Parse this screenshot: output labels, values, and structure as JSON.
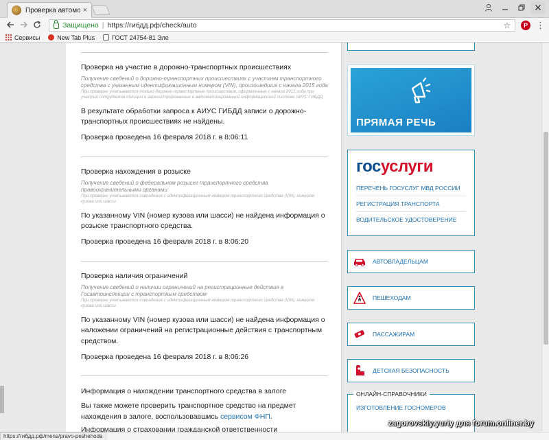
{
  "browser": {
    "tab_title": "Проверка автомобиля",
    "tab_close": "×",
    "secure_label": "Защищено",
    "url": "https://гибдд.рф/check/auto",
    "bookmarks": [
      {
        "label": "Сервисы"
      },
      {
        "label": "New Tab Plus"
      },
      {
        "label": "ГОСТ 24754-81 Эле"
      }
    ],
    "ext_label": "P",
    "icons": {
      "back": "back-arrow-icon",
      "forward": "forward-arrow-icon",
      "reload": "reload-icon",
      "star": "star-icon",
      "menu": "menu-icon"
    }
  },
  "sections": [
    {
      "title": "Проверка на участие в дорожно-транспортных происшествиях",
      "desc": "Получение сведений о дорожно-транспортных происшествиях с участием транспортного средства с указанным идентификационным номером (VIN), произошедших с начала 2015 года",
      "note": "При проверке учитываются только дорожно-транспортные происшествия, оформленные с начала 2015 года при участии сотрудников полиции и зарегистрированные в автоматизированной информационной системе АИУС ГИБДД",
      "result": "В результате обработки запроса к АИУС ГИБДД записи о дорожно-транспортных происшествиях не найдены.",
      "date": "Проверка проведена 16 февраля 2018 г. в 8:06:11"
    },
    {
      "title": "Проверка нахождения в розыске",
      "desc": "Получение сведений о федеральном розыске транспортного средства правоохранительными органами",
      "note": "При проверке учитываются совпадения с идентификационным номером транспортного средства (VIN), номером кузова или шасси",
      "result": "По указанному VIN (номер кузова или шасси) не найдена информация о розыске транспортного средства.",
      "date": "Проверка проведена 16 февраля 2018 г. в 8:06:20"
    },
    {
      "title": "Проверка наличия ограничений",
      "desc": "Получение сведений о наличии ограничений на регистрационные действия в Госавтоинспекции с транспортным средством",
      "note": "При проверке учитываются совпадения с идентификационным номером транспортного средства (VIN), номером кузова или шасси",
      "result": "По указанному VIN (номер кузова или шасси) не найдена информация о наложении ограничений на регистрационные действия с транспортным средством.",
      "date": "Проверка проведена 16 февраля 2018 г. в 8:06:26"
    },
    {
      "title": "Информация о нахождении транспортного средства в залоге",
      "result_prefix": "Вы также можете проверить транспортное средство на предмет нахождения в залоге, воспользовавшись ",
      "result_link": "сервисом ФНП",
      "result_suffix": ".",
      "next": "Информация о страховании гражданской ответственности"
    }
  ],
  "sidebar": {
    "promo_text": "ПРЯМАЯ РЕЧЬ",
    "gosuslugi": {
      "logo_a": "гос",
      "logo_b": "услуги",
      "links": [
        "ПЕРЕЧЕНЬ ГОСУСЛУГ МВД РОССИИ",
        "РЕГИСТРАЦИЯ ТРАНСПОРТА",
        "ВОДИТЕЛЬСКОЕ УДОСТОВЕРЕНИЕ"
      ]
    },
    "categories": [
      {
        "label": "АВТОВЛАДЕЛЬЦАМ",
        "icon": "car-icon"
      },
      {
        "label": "ПЕШЕХОДАМ",
        "icon": "pedestrian-icon"
      },
      {
        "label": "ПАССАЖИРАМ",
        "icon": "seatbelt-icon"
      },
      {
        "label": "ДЕТСКАЯ БЕЗОПАСНОСТЬ",
        "icon": "child-seat-icon"
      }
    ],
    "sprav_title": "ОНЛАЙН-СПРАВОЧНИКИ",
    "sprav_links": [
      "ИЗГОТОВЛЕНИЕ ГОСНОМЕРОВ"
    ]
  },
  "status": {
    "url": "https://гибдд.рф/mens/pravo-peshehoda",
    "watermark": "zagorovskiy.yuriy для forum.onliner.by"
  },
  "colors": {
    "accent": "#1a6fb3",
    "border": "#2f8fb8",
    "icon_red": "#d4112a"
  }
}
